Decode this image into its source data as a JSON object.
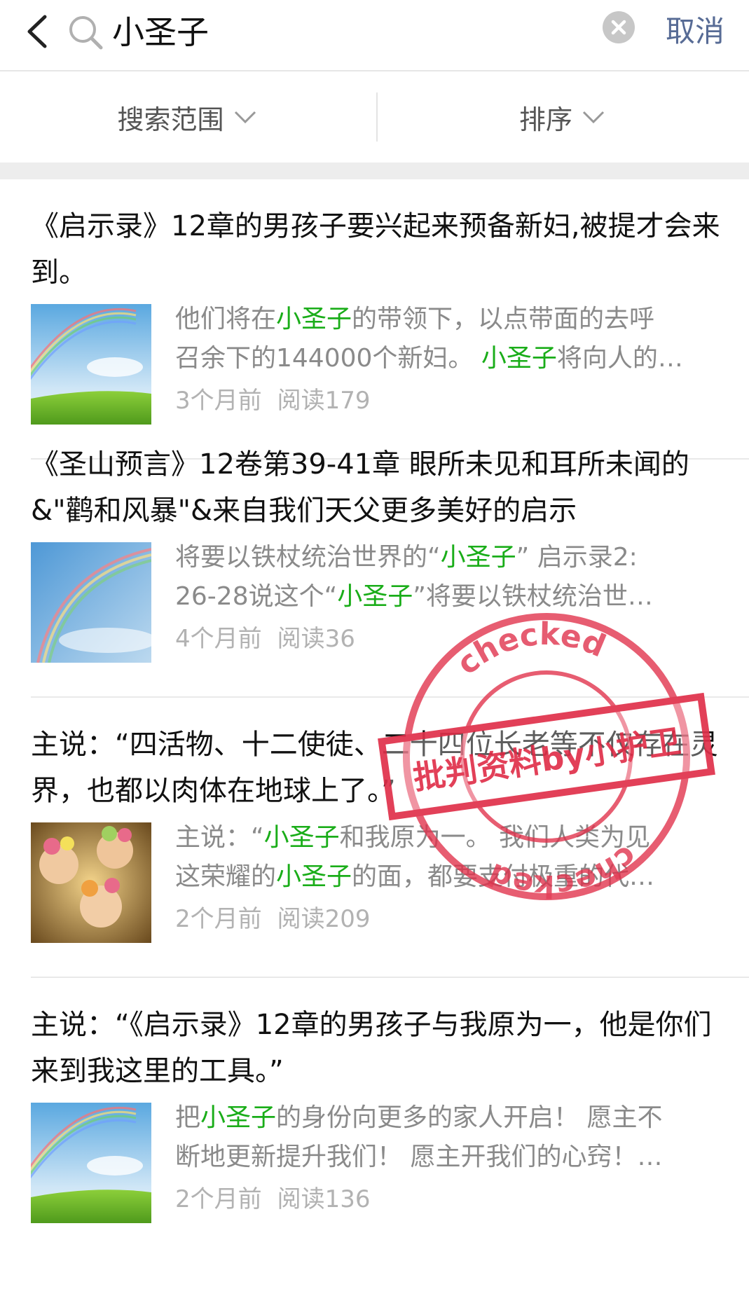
{
  "search": {
    "query": "小圣子",
    "cancel_label": "取消"
  },
  "filters": {
    "scope_label": "搜索范围",
    "sort_label": "排序"
  },
  "results": [
    {
      "title": "《启示录》12章的男孩子要兴起来预备新妇,被提才会来到。",
      "snippet_line1": [
        "他们将在",
        "小圣子",
        "的带领下，以点带面的去呼"
      ],
      "snippet_line2": [
        "召余下的144000个新妇。 ",
        "小圣子",
        "将向人的…"
      ],
      "time": "3个月前",
      "reads": "阅读179",
      "thumb": "rainbow-meadow"
    },
    {
      "title": "《圣山预言》12卷第39-41章 眼所未见和耳所未闻的&\"鹳和风暴\"&来自我们天父更多美好的启示",
      "snippet_line1": [
        "将要以铁杖统治世界的“",
        "小圣子",
        "” 启示录2:"
      ],
      "snippet_line2": [
        "26-28说这个“",
        "小圣子",
        "”将要以铁杖统治世…"
      ],
      "time": "4个月前",
      "reads": "阅读36",
      "thumb": "rainbow-sky"
    },
    {
      "title": "主说：“四活物、十二使徒、二十四位长老等不仅存在灵界，也都以肉体在地球上了。”",
      "snippet_line1": [
        "主说：“",
        "小圣子",
        "和我原为一。 我们人类为见"
      ],
      "snippet_line2": [
        "这荣耀的",
        "小圣子",
        "的面，都要支付极重的代…"
      ],
      "time": "2个月前",
      "reads": "阅读209",
      "thumb": "angels-painting"
    },
    {
      "title": "主说：“《启示录》12章的男孩子与我原为一，他是你们来到我这里的工具。”",
      "snippet_line1": [
        "把",
        "小圣子",
        "的身份向更多的家人开启！ 愿主不"
      ],
      "snippet_line2": [
        "断地更新提升我们！ 愿主开我们的心窍！…",
        "",
        ""
      ],
      "time": "2个月前",
      "reads": "阅读136",
      "thumb": "rainbow-meadow"
    }
  ],
  "stamp": {
    "text_main": "批判资料by小护卫",
    "text_ring": "checked"
  },
  "colors": {
    "highlight": "#1aad19",
    "cancel": "#576b95",
    "stamp": "#e0304a"
  }
}
